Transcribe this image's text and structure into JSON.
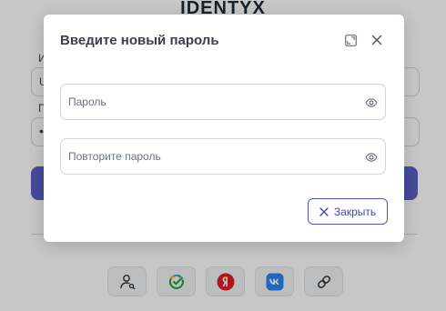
{
  "background": {
    "logo_text": "IDENTYX",
    "field_label_1": "И",
    "field_value_1": "U",
    "field_label_2": "П",
    "field_value_2": "•"
  },
  "modal": {
    "title": "Введите новый пароль",
    "password_placeholder": "Пароль",
    "confirm_placeholder": "Повторите пароль",
    "close_label": "Закрыть"
  },
  "social": {
    "items": [
      "user-key",
      "sber-id",
      "yandex",
      "vk",
      "link"
    ]
  },
  "colors": {
    "accent": "#5b5fc7",
    "overlay": "rgba(0,0,0,0.22)",
    "yandex": "#e11b22",
    "vk": "#2787f5",
    "sber": "#21a038"
  }
}
